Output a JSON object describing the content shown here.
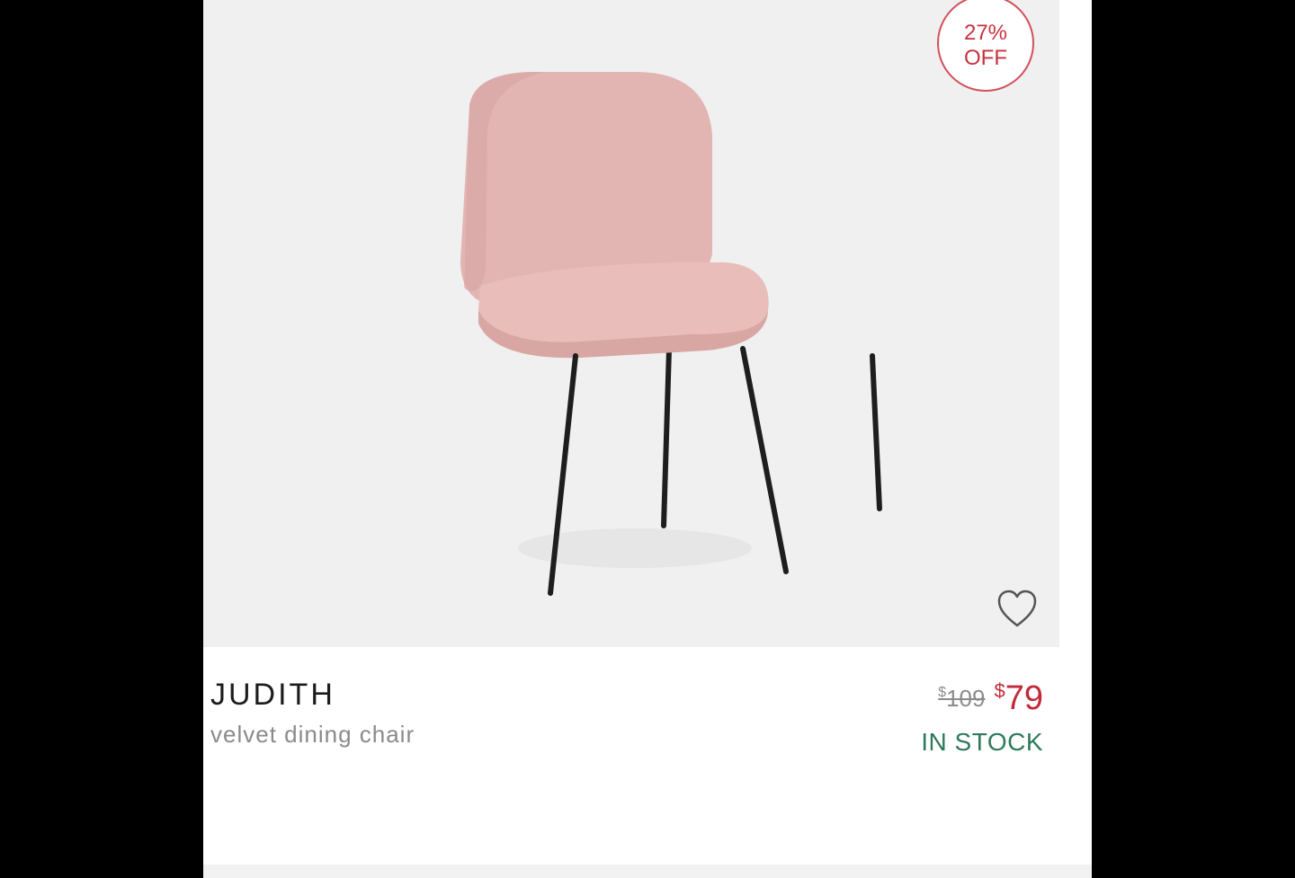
{
  "badge": {
    "percent": "27%",
    "off": "OFF"
  },
  "product": {
    "name": "JUDITH",
    "description": "velvet dining chair",
    "old_price_currency": "$",
    "old_price": "109",
    "new_price_currency": "$",
    "new_price": "79",
    "stock_status": "IN STOCK"
  },
  "icons": {
    "wishlist": "heart-icon"
  },
  "colors": {
    "badge_accent": "#c8323c",
    "sale_price": "#c22a3a",
    "stock": "#2f7a5c",
    "chair_fabric": "#e4b7b4",
    "chair_legs": "#1e1e1e"
  }
}
